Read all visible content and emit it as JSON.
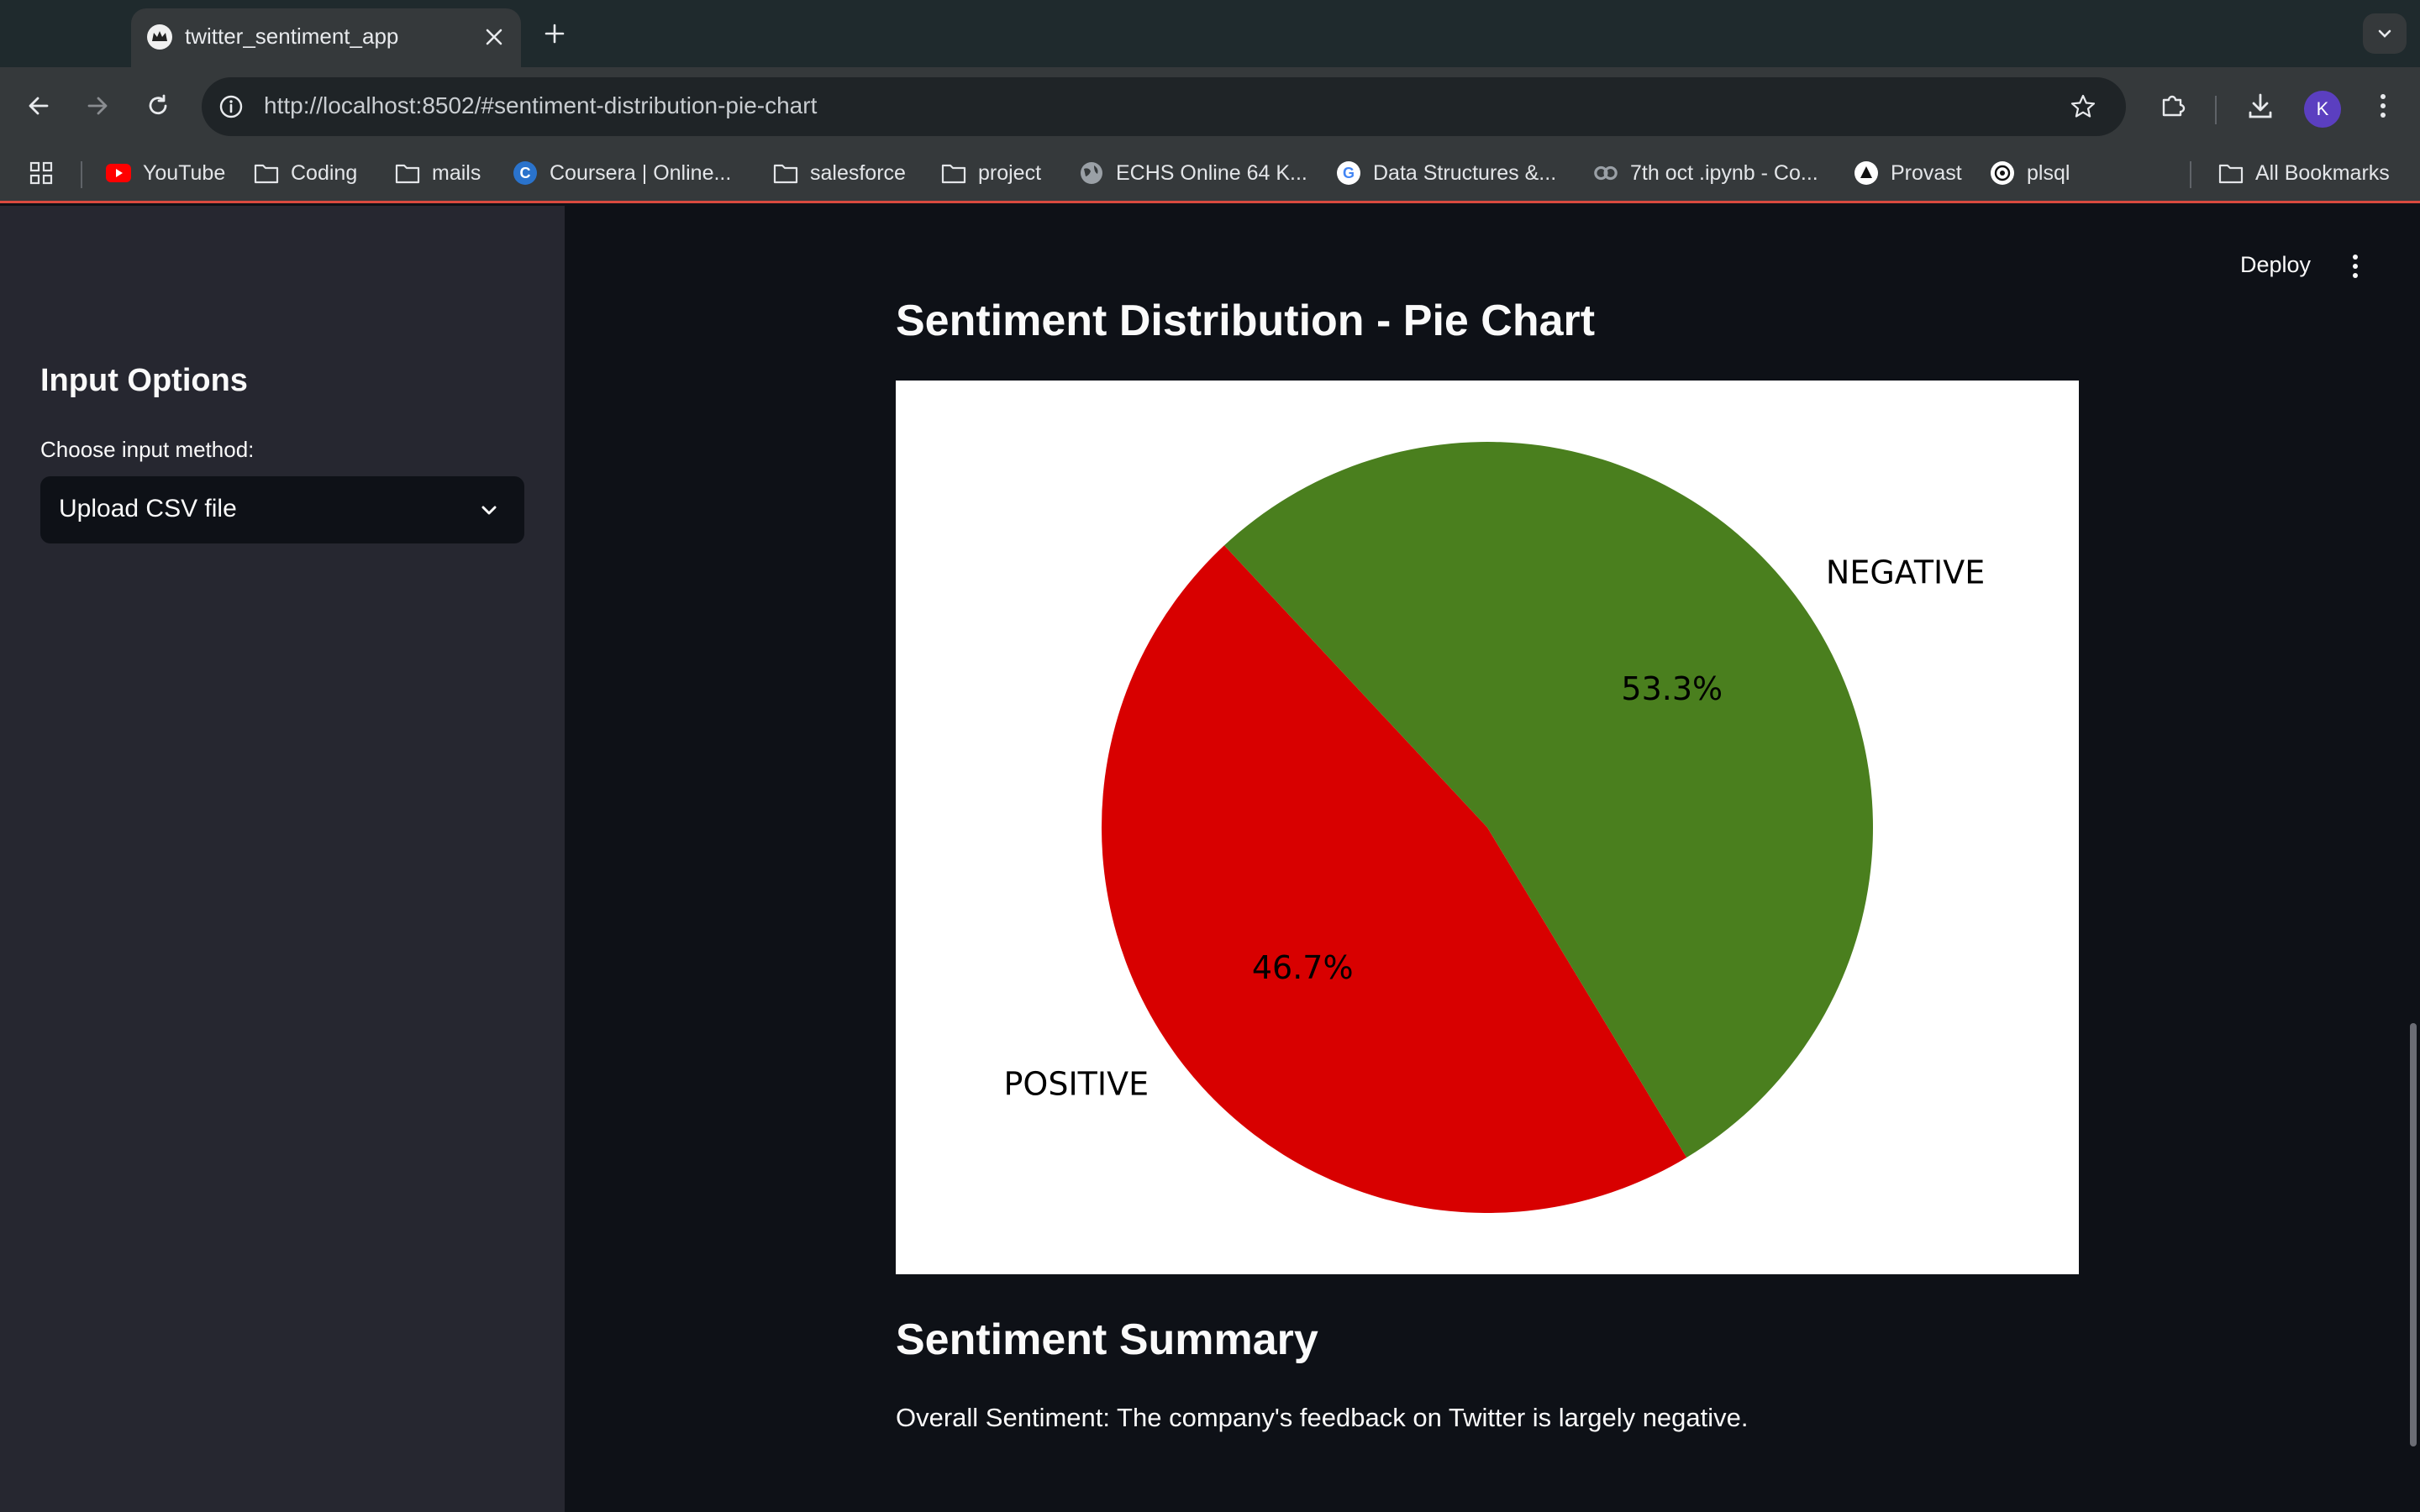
{
  "browser": {
    "tab_title": "twitter_sentiment_app",
    "url": "http://localhost:8502/#sentiment-distribution-pie-chart",
    "avatar_letter": "K",
    "bookmarks": [
      {
        "label": "YouTube",
        "icon": "youtube-icon"
      },
      {
        "label": "Coding",
        "icon": "folder-icon"
      },
      {
        "label": "mails",
        "icon": "folder-icon"
      },
      {
        "label": "Coursera | Online...",
        "icon": "coursera-icon"
      },
      {
        "label": "salesforce",
        "icon": "folder-icon"
      },
      {
        "label": "project",
        "icon": "folder-icon"
      },
      {
        "label": "ECHS Online 64 K...",
        "icon": "globe-icon"
      },
      {
        "label": "Data Structures &...",
        "icon": "google-icon"
      },
      {
        "label": "7th oct .ipynb - Co...",
        "icon": "colab-icon"
      },
      {
        "label": "Provast",
        "icon": "provast-icon"
      },
      {
        "label": "plsql",
        "icon": "openai-icon"
      }
    ],
    "all_bookmarks_label": "All Bookmarks"
  },
  "sidebar": {
    "title": "Input Options",
    "select_label": "Choose input method:",
    "select_value": "Upload CSV file"
  },
  "header": {
    "deploy_label": "Deploy"
  },
  "main": {
    "pie_heading": "Sentiment Distribution - Pie Chart",
    "summary_heading": "Sentiment Summary",
    "summary_text": "Overall Sentiment: The company's feedback on Twitter is largely negative."
  },
  "chart_data": {
    "type": "pie",
    "categories": [
      "POSITIVE",
      "NEGATIVE"
    ],
    "values": [
      46.7,
      53.3
    ],
    "data_labels": [
      "46.7%",
      "53.3%"
    ],
    "colors": [
      "#d80000",
      "#4a7f1e"
    ],
    "title": ""
  }
}
